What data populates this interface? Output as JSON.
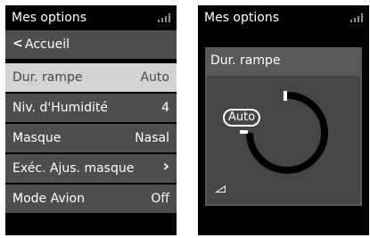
{
  "left_screen": {
    "header": {
      "title": "Mes options"
    },
    "menu": {
      "back_label": "Accueil",
      "items": [
        {
          "label": "Dur. rampe",
          "value": "Auto",
          "selected": true
        },
        {
          "label": "Niv. d'Humidité",
          "value": "4"
        },
        {
          "label": "Masque",
          "value": "Nasal"
        },
        {
          "label": "Exéc. Ajus. masque",
          "value": "›"
        },
        {
          "label": "Mode Avion",
          "value": "Off"
        }
      ]
    }
  },
  "right_screen": {
    "header": {
      "title": "Mes options"
    },
    "panel": {
      "title": "Dur. rampe",
      "value": "Auto"
    }
  },
  "icons": {
    "signal": "signal-strength-icon",
    "back": "chevron-left-icon",
    "forward": "chevron-right-icon",
    "ramp": "ramp-icon"
  },
  "colors": {
    "screen_bg": "#000000",
    "menu_bg": "#4e4e4e",
    "selected_bg": "#d3d3d3",
    "panel_bg": "#595959",
    "panel_body_bg": "#464646",
    "text": "#ffffff"
  }
}
